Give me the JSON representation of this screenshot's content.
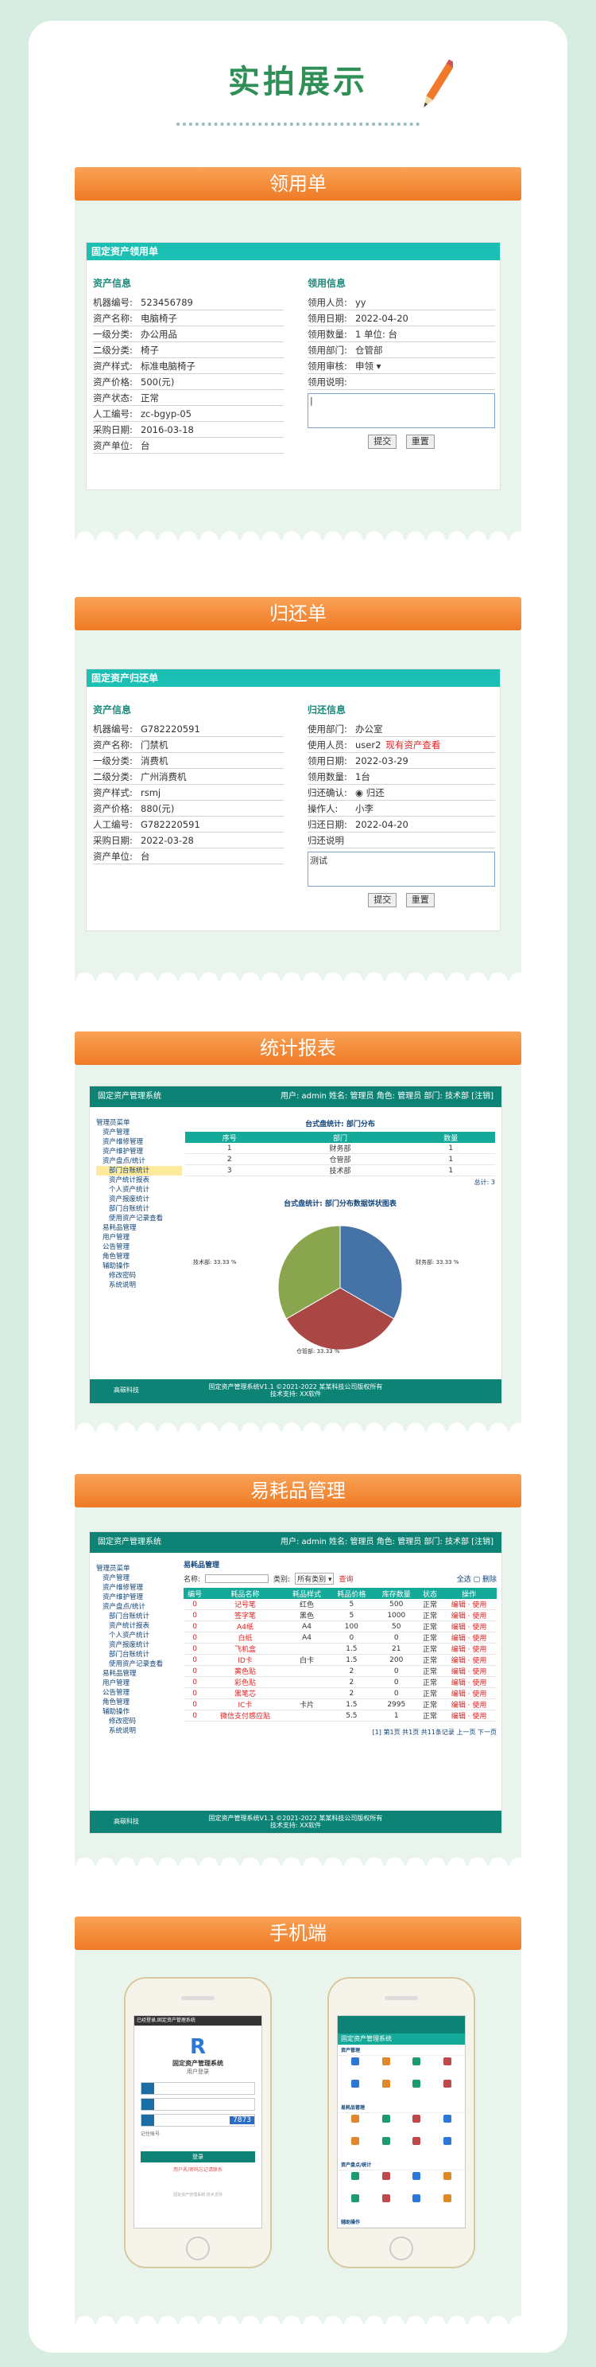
{
  "header": {
    "title": "实拍展示"
  },
  "panel1": {
    "ribbon": "领用单",
    "bar": "固定资产领用单",
    "left_title": "资产信息",
    "right_title": "领用信息",
    "left": [
      [
        "机器编号:",
        "523456789"
      ],
      [
        "资产名称:",
        "电脑椅子"
      ],
      [
        "一级分类:",
        "办公用品"
      ],
      [
        "二级分类:",
        "椅子"
      ],
      [
        "资产样式:",
        "标准电脑椅子"
      ],
      [
        "资产价格:",
        "500(元)"
      ],
      [
        "资产状态:",
        "正常"
      ],
      [
        "人工编号:",
        "zc-bgyp-05"
      ],
      [
        "采购日期:",
        "2016-03-18"
      ],
      [
        "资产单位:",
        "台"
      ]
    ],
    "right": [
      [
        "领用人员:",
        "yy"
      ],
      [
        "领用日期:",
        "2022-04-20"
      ],
      [
        "领用数量:",
        "1 单位: 台"
      ],
      [
        "领用部门:",
        "仓管部"
      ],
      [
        "领用审核:",
        "申领 ▾"
      ],
      [
        "领用说明:",
        ""
      ]
    ],
    "submit": "提交",
    "reset": "重置"
  },
  "panel2": {
    "ribbon": "归还单",
    "bar": "固定资产归还单",
    "left_title": "资产信息",
    "right_title": "归还信息",
    "left": [
      [
        "机器编号:",
        "G782220591"
      ],
      [
        "资产名称:",
        "门禁机"
      ],
      [
        "一级分类:",
        "消费机"
      ],
      [
        "二级分类:",
        "广州消费机"
      ],
      [
        "资产样式:",
        "rsmj"
      ],
      [
        "资产价格:",
        "880(元)"
      ],
      [
        "人工编号:",
        "G782220591"
      ],
      [
        "采购日期:",
        "2022-03-28"
      ],
      [
        "资产单位:",
        "台"
      ]
    ],
    "right": [
      [
        "使用部门:",
        "办公室"
      ],
      [
        "使用人员:",
        "user2"
      ],
      [
        "领用日期:",
        "2022-03-29"
      ],
      [
        "领用数量:",
        "1台"
      ],
      [
        "归还确认:",
        "◉ 归还"
      ],
      [
        "操作人:",
        "小李"
      ],
      [
        "归还日期:",
        "2022-04-20"
      ],
      [
        "归还说明",
        ""
      ]
    ],
    "red_note": "现有资产查看",
    "ta_text": "测试",
    "submit": "提交",
    "reset": "重置"
  },
  "panel3": {
    "ribbon": "统计报表",
    "app_title": "固定资产管理系统",
    "user_info": "用户: admin  姓名: 管理员  角色: 管理员  部门: 技术部  [注销]",
    "sidebar": [
      "管理员菜单",
      "资产管理",
      "资产维修管理",
      "资产维护管理",
      "资产盘点/统计",
      "部门台账统计",
      "资产统计报表",
      "个人资产统计",
      "资产报废统计",
      "部门台账统计",
      "使用资产记录查看",
      "易耗品管理",
      "用户管理",
      "公告管理",
      "角色管理",
      "辅助操作",
      "修改密码",
      "系统说明"
    ],
    "table_title": "台式盘统计: 部门分布",
    "cols": [
      "序号",
      "部门",
      "数量"
    ],
    "rows": [
      [
        "1",
        "财务部",
        "1"
      ],
      [
        "2",
        "仓管部",
        "1"
      ],
      [
        "3",
        "技术部",
        "1"
      ]
    ],
    "total": "总计: 3",
    "pie_title": "台式盘统计: 部门分布数据饼状图表",
    "footer1": "固定资产管理系统V1.1 ©2021-2022 某某科技公司版权所有",
    "footer2": "技术支持: XX软件",
    "logo": "高碳科技"
  },
  "chart_data": {
    "type": "pie",
    "categories": [
      "财务部",
      "仓管部",
      "技术部"
    ],
    "values": [
      33.33,
      33.33,
      33.33
    ],
    "labels": [
      "技术部: 33.33 %",
      "财务部: 33.33 %",
      "仓管部: 33.33 %"
    ],
    "colors": [
      "#4572a7",
      "#aa4643",
      "#89a54e"
    ]
  },
  "panel4": {
    "ribbon": "易耗品管理",
    "breadcrumb": "易耗品管理",
    "search_label": "名称:",
    "search_type": "类别:",
    "search_select": "所有类别 ▾",
    "search_btn": "查询",
    "actions": "全选 ▢  删除",
    "cols": [
      "编号",
      "耗品名称",
      "耗品样式",
      "耗品价格",
      "库存数量",
      "状态",
      "操作"
    ],
    "rows": [
      [
        "0",
        "记号笔",
        "红色",
        "5",
        "500",
        "正常",
        "编辑 · 使用"
      ],
      [
        "0",
        "签字笔",
        "黑色",
        "5",
        "1000",
        "正常",
        "编辑 · 使用"
      ],
      [
        "0",
        "A4纸",
        "A4",
        "100",
        "50",
        "正常",
        "编辑 · 使用"
      ],
      [
        "0",
        "白纸",
        "A4",
        "0",
        "0",
        "正常",
        "编辑 · 使用"
      ],
      [
        "0",
        "飞机盒",
        "",
        "1.5",
        "21",
        "正常",
        "编辑 · 使用"
      ],
      [
        "0",
        "ID卡",
        "白卡",
        "1.5",
        "200",
        "正常",
        "编辑 · 使用"
      ],
      [
        "0",
        "黄色贴",
        "",
        "2",
        "0",
        "正常",
        "编辑 · 使用"
      ],
      [
        "0",
        "彩色贴",
        "",
        "2",
        "0",
        "正常",
        "编辑 · 使用"
      ],
      [
        "0",
        "黑笔芯",
        "",
        "2",
        "0",
        "正常",
        "编辑 · 使用"
      ],
      [
        "0",
        "IC卡",
        "卡片",
        "1.5",
        "2995",
        "正常",
        "编辑 · 使用"
      ],
      [
        "0",
        "微信支付感应贴",
        "",
        "5.5",
        "1",
        "正常",
        "编辑 · 使用"
      ]
    ],
    "pager": "[1] 第1页 共1页 共11条记录 上一页 下一页"
  },
  "panel5": {
    "ribbon": "手机端",
    "login": {
      "title": "固定资产管理系统",
      "subtitle": "用户登录",
      "code": "7873",
      "remember": "记住账号",
      "btn": "登录",
      "link": "用户名/密码忘记请联系",
      "top": "已经登录,固定资产管理系统",
      "footer": "固定资产管理系统 技术支持"
    },
    "menu": {
      "title": "固定资产管理系统",
      "sections": [
        "资产管理",
        "易耗品管理",
        "资产盘点/统计",
        "辅助操作"
      ]
    }
  }
}
